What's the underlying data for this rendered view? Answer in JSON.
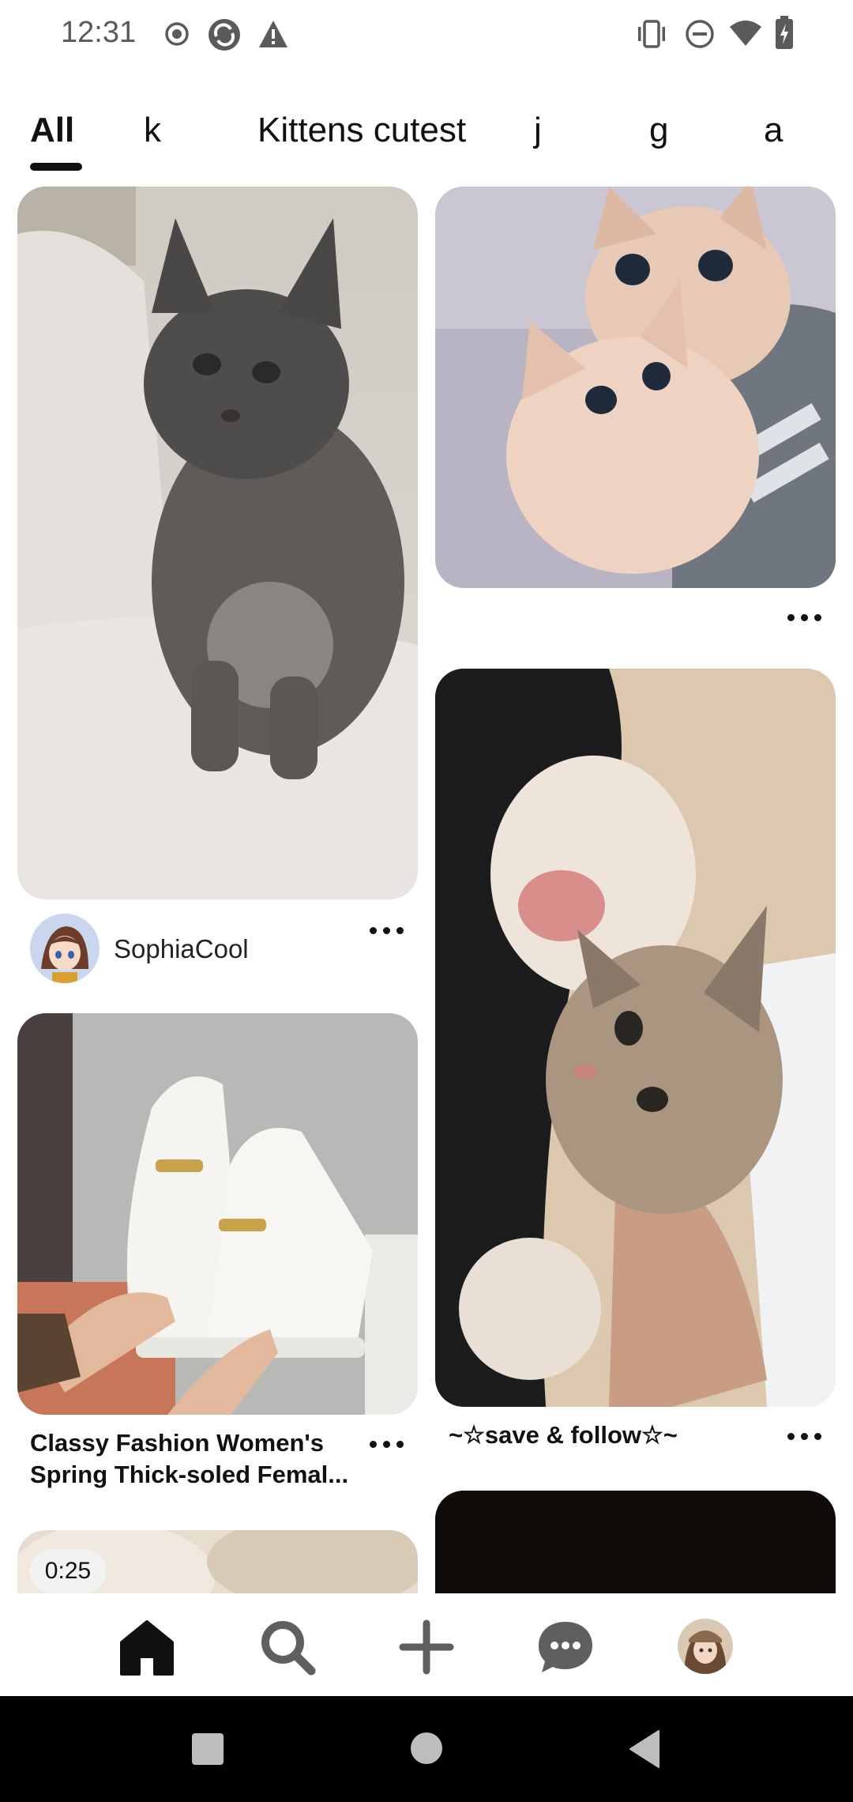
{
  "status_bar": {
    "time": "12:31",
    "left_icons": [
      "record-icon",
      "sync-icon",
      "warning-icon"
    ],
    "right_icons": [
      "vibrate-icon",
      "do-not-disturb-icon",
      "wifi-icon",
      "battery-icon"
    ]
  },
  "tabs": [
    {
      "label": "All",
      "active": true
    },
    {
      "label": "k",
      "active": false
    },
    {
      "label": "Kittens cutest",
      "active": false
    },
    {
      "label": "j",
      "active": false
    },
    {
      "label": "g",
      "active": false
    },
    {
      "label": "a",
      "active": false
    }
  ],
  "feed": {
    "pins": [
      {
        "image": "gray fluffy kitten on white blanket",
        "author": "SophiaCool"
      },
      {
        "image": "two cream kittens hugging arm"
      },
      {
        "image": "kitten held in arms reaching paw",
        "title": "~☆save & follow☆~"
      },
      {
        "image": "white chunky loafers held in hands",
        "title": "Classy Fashion Women's Spring Thick-soled Femal..."
      },
      {
        "image": "fluffy white fur video",
        "video_duration": "0:25"
      },
      {
        "image": "dark video pin"
      }
    ]
  },
  "bottom_nav": {
    "items": [
      "home-icon",
      "search-icon",
      "create-icon",
      "messages-icon",
      "profile-avatar"
    ]
  },
  "system_nav": [
    "recents-icon",
    "home-circle-icon",
    "back-icon"
  ],
  "colors": {
    "text": "#111111",
    "background": "#ffffff",
    "nav_bar": "#000000"
  }
}
